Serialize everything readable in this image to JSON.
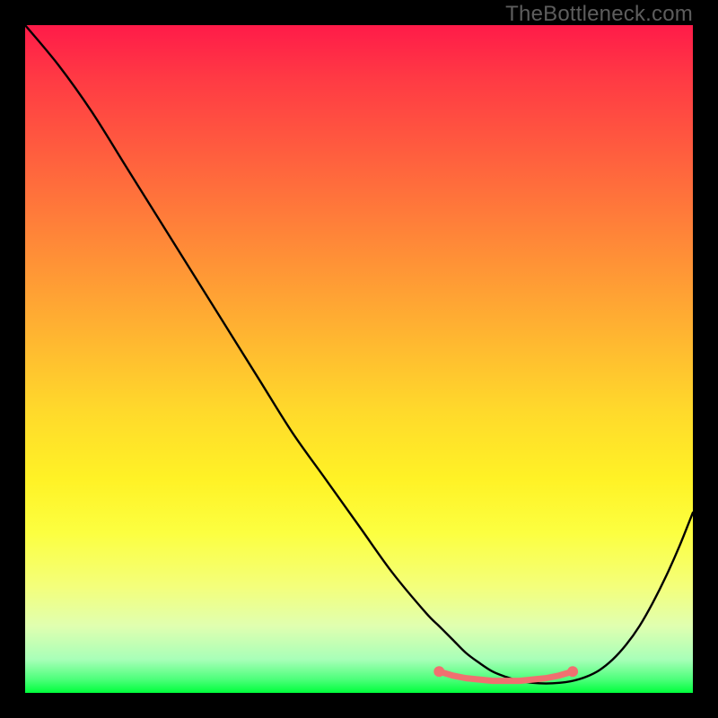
{
  "watermark": "TheBottleneck.com",
  "chart_data": {
    "type": "line",
    "title": "",
    "xlabel": "",
    "ylabel": "",
    "xlim": [
      0,
      100
    ],
    "ylim": [
      0,
      100
    ],
    "series": [
      {
        "name": "curve",
        "x": [
          0,
          5,
          10,
          15,
          20,
          25,
          30,
          35,
          40,
          45,
          50,
          55,
          60,
          62,
          64,
          66,
          68,
          70,
          72,
          74,
          76,
          78,
          80,
          82,
          84,
          86,
          88,
          90,
          92,
          94,
          96,
          98,
          100
        ],
        "y": [
          100,
          94,
          87,
          79,
          71,
          63,
          55,
          47,
          39,
          32,
          25,
          18,
          12,
          10,
          8,
          6,
          4.5,
          3.2,
          2.4,
          1.8,
          1.5,
          1.4,
          1.5,
          1.8,
          2.4,
          3.4,
          5.0,
          7.2,
          10,
          13.5,
          17.5,
          22,
          27
        ]
      },
      {
        "name": "marker-band",
        "x": [
          62,
          64,
          66,
          68,
          70,
          72,
          74,
          76,
          78,
          80,
          82
        ],
        "y": [
          3.2,
          2.6,
          2.2,
          2.0,
          1.8,
          1.8,
          1.8,
          2.0,
          2.2,
          2.6,
          3.2
        ]
      }
    ],
    "colors": {
      "curve": "#000000",
      "markers": "#f07070"
    }
  }
}
